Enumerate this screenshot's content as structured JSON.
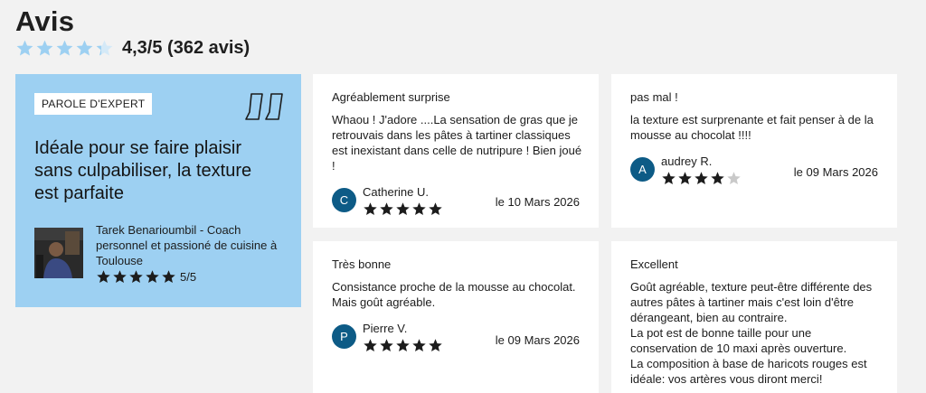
{
  "header": {
    "title": "Avis",
    "average_score": 4.3,
    "rating_summary": "4,3/5 (362 avis)",
    "star_color": "#9dd0f2"
  },
  "expert": {
    "badge": "PAROLE D'EXPERT",
    "quote_lines": [
      "Idéale pour se faire plaisir",
      "sans culpabiliser, la texture",
      "est parfaite"
    ],
    "name_lines": [
      "Tarek Benarioumbil - Coach",
      "personnel et passioné de cuisine à",
      "Toulouse"
    ],
    "stars": 5,
    "score": "5/5",
    "background": "#9dd0f2"
  },
  "reviews": [
    {
      "title": "Agréablement surprise",
      "body_lines": [
        "Whaou ! J'adore ....La sensation de gras que je",
        "retrouvais dans les pâtes à tartiner classiques",
        "est inexistant dans celle de nutripure ! Bien joué",
        "!"
      ],
      "initial": "C",
      "author": "Catherine U.",
      "stars": 5,
      "date": "le  10 Mars 2026"
    },
    {
      "title": "pas mal !",
      "body_lines": [
        "la texture est surprenante et fait penser à de la",
        "mousse au chocolat !!!!"
      ],
      "initial": "A",
      "author": "audrey R.",
      "stars": 4,
      "date": "le  09 Mars 2026"
    },
    {
      "title": "Très bonne",
      "body_lines": [
        "Consistance proche de la mousse au chocolat.",
        "Mais goût agréable."
      ],
      "initial": "P",
      "author": "Pierre V.",
      "stars": 5,
      "date": "le  09 Mars 2026"
    },
    {
      "title": "Excellent",
      "body_lines": [
        "Goût agréable, texture peut-être différente des",
        "autres pâtes à tartiner mais c'est loin d'être",
        "dérangeant, bien au contraire.",
        "La pot est de bonne taille pour une",
        "conservation de 10 maxi après ouverture.",
        "La composition à base de haricots rouges est",
        "idéale: vos artères vous diront merci!"
      ],
      "author": "",
      "stars": 0,
      "date": ""
    }
  ],
  "colors": {
    "avatar": "#0d5b86",
    "star_filled": "#1c1c1c",
    "star_empty": "#c9c9c9"
  }
}
